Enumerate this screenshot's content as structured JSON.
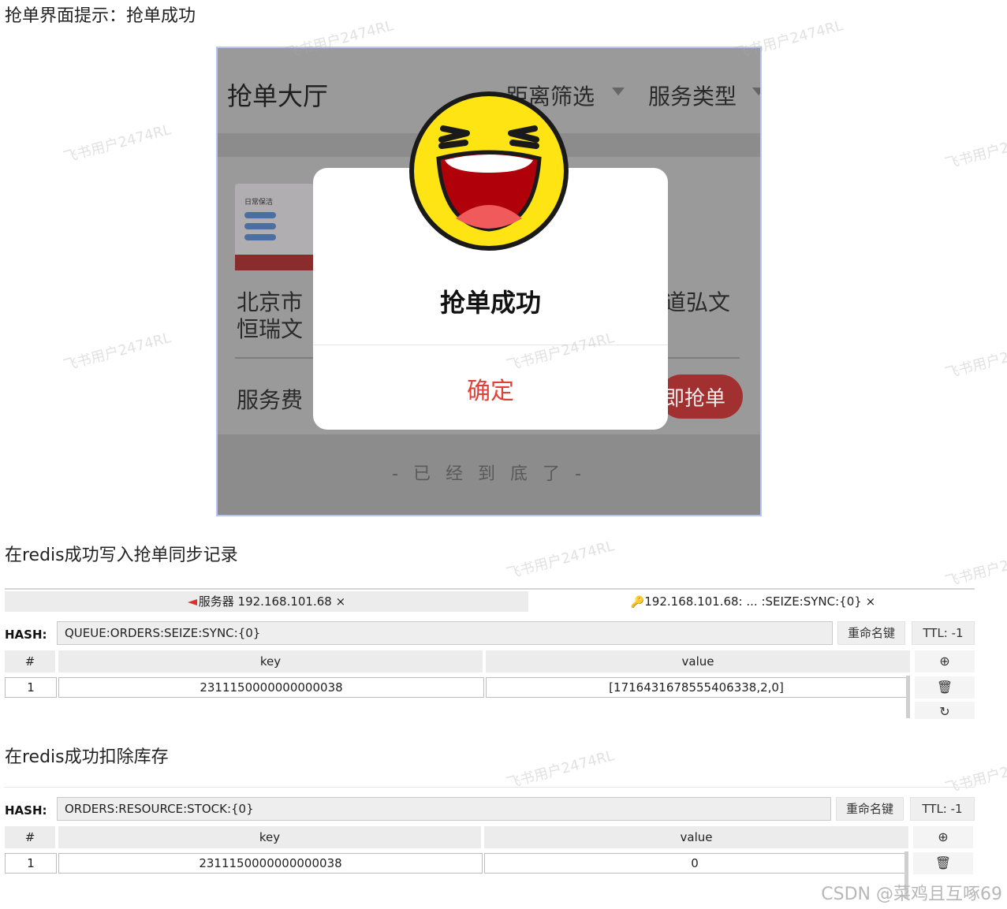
{
  "headings": {
    "h1": "抢单界面提示：抢单成功",
    "h2": "在redis成功写入抢单同步记录",
    "h3": "在redis成功扣除库存"
  },
  "phone": {
    "title": "抢单大厅",
    "filter_distance": "距离筛选",
    "filter_service": "服务类型",
    "thumb_title": "日常保洁",
    "card_text_left_1": "北京市",
    "card_text_left_2": "恒瑞文",
    "card_text_right": "道弘文",
    "fee_label": "服务费",
    "grab_button": "即抢单",
    "end_text": "- 已 经 到 底 了 -",
    "modal": {
      "title": "抢单成功",
      "confirm": "确定"
    }
  },
  "tabs": {
    "tab1": "服务器 192.168.101.68",
    "tab2": "192.168.101.68: ... :SEIZE:SYNC:{0}",
    "close": "×"
  },
  "table1": {
    "hash_label": "HASH:",
    "hash_key": "QUEUE:ORDERS:SEIZE:SYNC:{0}",
    "rename": "重命名键",
    "ttl": "TTL: -1",
    "col_index": "#",
    "col_key": "key",
    "col_value": "value",
    "rows": [
      {
        "index": "1",
        "key": "2311150000000000038",
        "value": "[1716431678555406338,2,0]"
      }
    ]
  },
  "table2": {
    "hash_label": "HASH:",
    "hash_key": "ORDERS:RESOURCE:STOCK:{0}",
    "rename": "重命名键",
    "ttl": "TTL: -1",
    "col_index": "#",
    "col_key": "key",
    "col_value": "value",
    "rows": [
      {
        "index": "1",
        "key": "2311150000000000038",
        "value": "0"
      }
    ]
  },
  "watermark": "飞书用户2474RL",
  "footer": "CSDN @菜鸡且互啄69",
  "colors": {
    "accent_red": "#e0403a",
    "grab_red": "#a33030",
    "emoji_yellow": "#ffe414"
  }
}
